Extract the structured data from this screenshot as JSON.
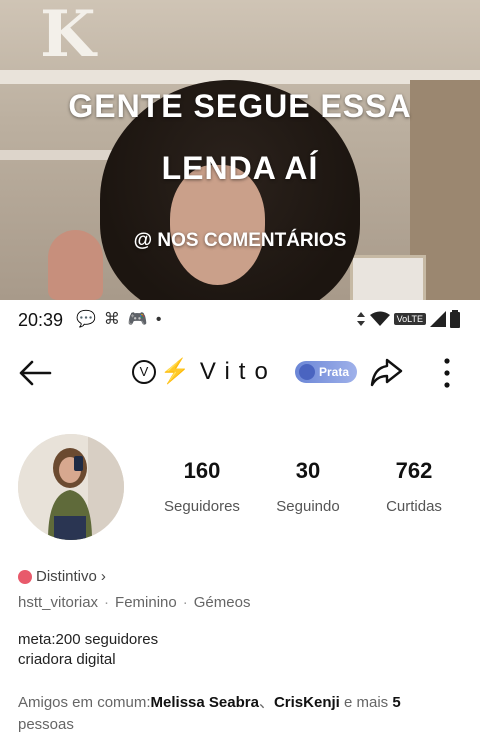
{
  "video": {
    "overlay_line1": "GENTE SEGUE ESSA",
    "overlay_line2": "LENDA AÍ",
    "overlay_line3": "@ NOS COMENTÁRIOS"
  },
  "status_bar": {
    "time": "20:39",
    "left_icons": [
      "message-bubble-icon",
      "notification-icon",
      "gamepad-icon",
      "dot-icon"
    ],
    "right_icons": [
      "data-arrows-icon",
      "wifi-icon",
      "volte-badge",
      "signal-icon",
      "battery-icon"
    ],
    "volte_label": "VoLTE"
  },
  "header": {
    "profile_name": "Vito",
    "title_prefix_icon": "v-circle-icon",
    "title_bolt_icon": "lightning-icon",
    "badge_label": "Prata"
  },
  "stats": [
    {
      "value": "160",
      "label": "Seguidores"
    },
    {
      "value": "30",
      "label": "Seguindo"
    },
    {
      "value": "762",
      "label": "Curtidas"
    }
  ],
  "profile": {
    "distintivo_label": "Distintivo",
    "username": "hstt_vitoriax",
    "gender": "Feminino",
    "sign": "Gémeos",
    "bio_line1": "meta:200 seguidores",
    "bio_line2": "criadora digital"
  },
  "friends": {
    "prefix": "Amigos em comum:",
    "name1": "Melissa Seabra",
    "separator": "、",
    "name2": "CrisKenji",
    "middle": " e mais ",
    "count": "5",
    "suffix": "pessoas"
  },
  "colors": {
    "bolt": "#f5b800",
    "badge": "#7a92de",
    "distintivo_icon": "#e85a6b"
  }
}
